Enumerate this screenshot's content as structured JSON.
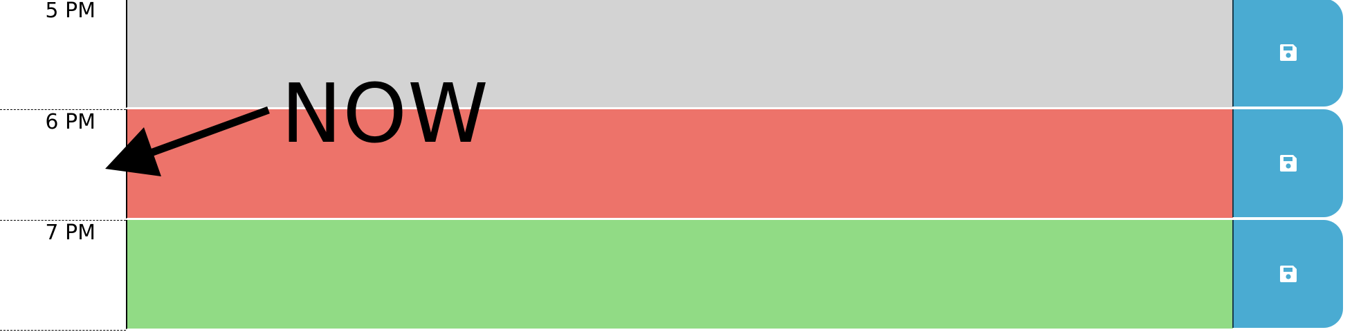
{
  "colors": {
    "past": "#d3d3d3",
    "present": "#ed736a",
    "future": "#91db85",
    "save_button": "#4aabd2",
    "save_icon": "#ffffff"
  },
  "annotation": {
    "now_label": "NOW",
    "arrow_icon": "arrow-icon"
  },
  "rows": [
    {
      "hour_label": "5 PM",
      "status": "past",
      "description": "",
      "save_icon": "floppy-disk-icon"
    },
    {
      "hour_label": "6 PM",
      "status": "present",
      "description": "",
      "save_icon": "floppy-disk-icon"
    },
    {
      "hour_label": "7 PM",
      "status": "future",
      "description": "",
      "save_icon": "floppy-disk-icon"
    }
  ]
}
